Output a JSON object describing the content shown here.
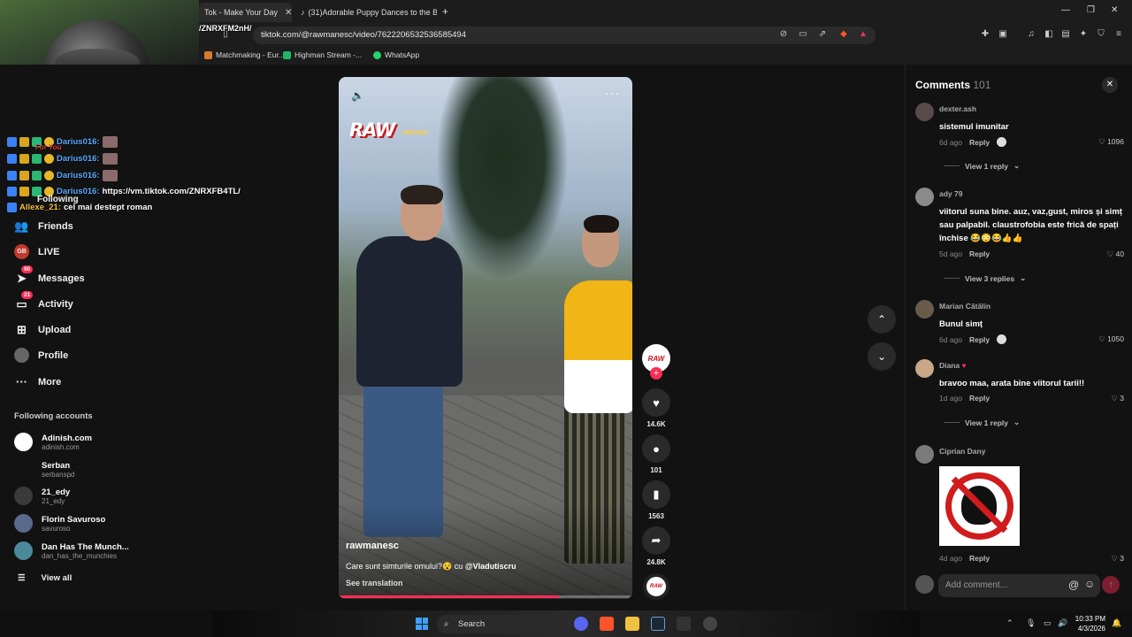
{
  "browser": {
    "tabs": [
      {
        "title": "Tok - Make Your Day",
        "active": true
      },
      {
        "title": "(31)Adorable Puppy Dances to the Be",
        "active": false
      }
    ],
    "url": "tiktok.com/@rawmanesc/video/7622206532536585494",
    "bookmarks": [
      "Matchmaking - Eur...",
      "Highman Stream -...",
      "WhatsApp"
    ]
  },
  "stream_overlay": {
    "url_fragment": "/ZNRXFM2nH/",
    "chat": [
      {
        "name": "Darius016:",
        "msg": ""
      },
      {
        "name": "Darius016:",
        "msg": ""
      },
      {
        "name": "Darius016:",
        "msg": ""
      },
      {
        "name": "Darius016:",
        "msg": "https://vm.tiktok.com/ZNRXFB4TL/"
      },
      {
        "name": "Allexe_21:",
        "msg": "cel mai destept roman"
      }
    ],
    "fyp_fragment": "For You"
  },
  "sidebar": {
    "items": [
      {
        "label": "Following",
        "icon": "following-icon"
      },
      {
        "label": "Friends",
        "icon": "friends-icon"
      },
      {
        "label": "LIVE",
        "icon": "live-icon"
      },
      {
        "label": "Messages",
        "icon": "messages-icon",
        "badge": "90"
      },
      {
        "label": "Activity",
        "icon": "activity-icon",
        "badge": "21"
      },
      {
        "label": "Upload",
        "icon": "upload-icon"
      },
      {
        "label": "Profile",
        "icon": "profile-icon"
      },
      {
        "label": "More",
        "icon": "more-icon"
      }
    ],
    "following_title": "Following accounts",
    "accounts": [
      {
        "name": "Adinish.com",
        "handle": "adinish.com"
      },
      {
        "name": "Serban",
        "handle": "serbanspd"
      },
      {
        "name": "21_edy",
        "handle": "21_edy"
      },
      {
        "name": "Florin Savuroso",
        "handle": "savuroso"
      },
      {
        "name": "Dan Has The Munch...",
        "handle": "dan_has_the_munchies"
      }
    ],
    "view_all": "View all"
  },
  "video": {
    "logo": "RAW",
    "logo_sub": "mânesc",
    "author": "rawmanesc",
    "description": "Care sunt simturile omului?",
    "desc_emoji": "😵",
    "desc_with": "cu",
    "desc_mention": "@Vladutiscru",
    "see_translation": "See translation",
    "progress": 0.75
  },
  "actions": {
    "likes": "14.6K",
    "comments": "101",
    "saves": "1563",
    "shares": "24.8K"
  },
  "comments_panel": {
    "title": "Comments",
    "count": "101",
    "add_placeholder": "Add comment...",
    "items": [
      {
        "user": "dexter.ash",
        "text": "sistemul imunitar",
        "age": "6d ago",
        "reply": "Reply",
        "likes": "1096",
        "view_replies": "View 1 reply"
      },
      {
        "user": "ady 79",
        "text": "viitorul suna bine. auz, vaz,gust, miros și simț sau palpabil. claustrofobia este frică de spați închise 😂😳😂👍👍",
        "age": "5d ago",
        "reply": "Reply",
        "likes": "40",
        "view_replies": "View 3 replies"
      },
      {
        "user": "Marian Cătălin",
        "text": "Bunul simț",
        "age": "6d ago",
        "reply": "Reply",
        "likes": "1050"
      },
      {
        "user": "Diana",
        "text": "bravoo maa, arata bine viitorul tarii!!",
        "age": "1d ago",
        "reply": "Reply",
        "likes": "3",
        "view_replies": "View 1 reply"
      },
      {
        "user": "Ciprian Dany",
        "text": "",
        "age": "4d ago",
        "reply": "Reply",
        "likes": "3"
      }
    ]
  },
  "taskbar": {
    "search": "Search",
    "time": "10:33 PM",
    "date": "4/3/2026"
  }
}
